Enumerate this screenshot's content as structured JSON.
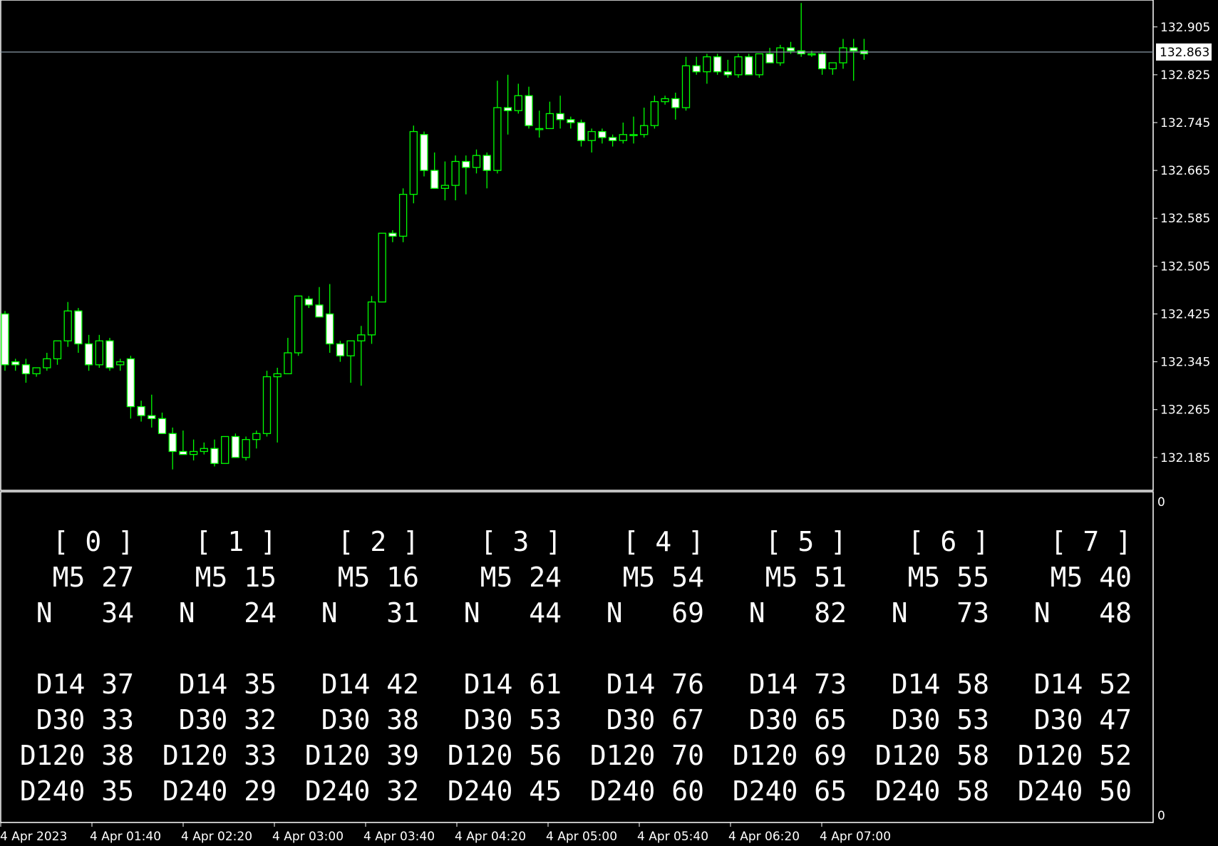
{
  "symbol_colors": {
    "background": "#000000",
    "bull_candle": "#00ff00",
    "bear_candle_fill": "#ffffff",
    "grid_line": "#ffffff",
    "bid_line": "#8a9aa6"
  },
  "price_axis": {
    "ticks": [
      "132.905",
      "132.825",
      "132.745",
      "132.665",
      "132.585",
      "132.505",
      "132.425",
      "132.345",
      "132.265",
      "132.185"
    ],
    "current_price": "132.863",
    "range": [
      132.13,
      132.95
    ]
  },
  "indicator_axis": {
    "top_label": "0",
    "bottom_label": "0"
  },
  "time_axis": {
    "labels": [
      "4 Apr 2023",
      "4 Apr 01:40",
      "4 Apr 02:20",
      "4 Apr 03:00",
      "4 Apr 03:40",
      "4 Apr 04:20",
      "4 Apr 05:00",
      "4 Apr 05:40",
      "4 Apr 06:20",
      "4 Apr 07:00"
    ]
  },
  "chart_data": {
    "type": "candlestick",
    "timeframe_minutes": 5,
    "start_time": "4 Apr 2023 00:00",
    "ohlc": [
      [
        132.425,
        132.43,
        132.33,
        132.34
      ],
      [
        132.345,
        132.35,
        132.33,
        132.34
      ],
      [
        132.34,
        132.35,
        132.31,
        132.325
      ],
      [
        132.325,
        132.335,
        132.32,
        132.335
      ],
      [
        132.335,
        132.36,
        132.33,
        132.35
      ],
      [
        132.35,
        132.38,
        132.34,
        132.38
      ],
      [
        132.38,
        132.445,
        132.37,
        132.43
      ],
      [
        132.43,
        132.435,
        132.36,
        132.375
      ],
      [
        132.375,
        132.39,
        132.33,
        132.34
      ],
      [
        132.34,
        132.39,
        132.335,
        132.38
      ],
      [
        132.38,
        132.385,
        132.33,
        132.335
      ],
      [
        132.34,
        132.35,
        132.33,
        132.345
      ],
      [
        132.35,
        132.355,
        132.25,
        132.27
      ],
      [
        132.27,
        132.28,
        132.245,
        132.255
      ],
      [
        132.255,
        132.29,
        132.235,
        132.25
      ],
      [
        132.25,
        132.26,
        132.23,
        132.225
      ],
      [
        132.225,
        132.235,
        132.165,
        132.195
      ],
      [
        132.195,
        132.23,
        132.19,
        132.19
      ],
      [
        132.19,
        132.215,
        132.18,
        132.195
      ],
      [
        132.195,
        132.21,
        132.19,
        132.2
      ],
      [
        132.2,
        132.215,
        132.17,
        132.175
      ],
      [
        132.175,
        132.22,
        132.175,
        132.22
      ],
      [
        132.22,
        132.225,
        132.185,
        132.185
      ],
      [
        132.185,
        132.22,
        132.18,
        132.215
      ],
      [
        132.215,
        132.23,
        132.2,
        132.225
      ],
      [
        132.225,
        132.33,
        132.22,
        132.32
      ],
      [
        132.32,
        132.335,
        132.21,
        132.325
      ],
      [
        132.325,
        132.385,
        132.325,
        132.36
      ],
      [
        132.36,
        132.455,
        132.355,
        132.455
      ],
      [
        132.45,
        132.455,
        132.435,
        132.44
      ],
      [
        132.44,
        132.47,
        132.42,
        132.42
      ],
      [
        132.425,
        132.475,
        132.36,
        132.375
      ],
      [
        132.375,
        132.38,
        132.345,
        132.355
      ],
      [
        132.355,
        132.375,
        132.31,
        132.38
      ],
      [
        132.38,
        132.405,
        132.305,
        132.39
      ],
      [
        132.39,
        132.455,
        132.375,
        132.445
      ],
      [
        132.445,
        132.56,
        132.445,
        132.56
      ],
      [
        132.56,
        132.565,
        132.545,
        132.555
      ],
      [
        132.555,
        132.635,
        132.545,
        132.625
      ],
      [
        132.625,
        132.74,
        132.61,
        132.73
      ],
      [
        132.725,
        132.73,
        132.655,
        132.665
      ],
      [
        132.665,
        132.695,
        132.635,
        132.635
      ],
      [
        132.635,
        132.68,
        132.615,
        132.64
      ],
      [
        132.64,
        132.69,
        132.615,
        132.68
      ],
      [
        132.68,
        132.69,
        132.625,
        132.67
      ],
      [
        132.67,
        132.7,
        132.66,
        132.69
      ],
      [
        132.69,
        132.695,
        132.635,
        132.665
      ],
      [
        132.665,
        132.815,
        132.66,
        132.77
      ],
      [
        132.77,
        132.825,
        132.725,
        132.765
      ],
      [
        132.765,
        132.81,
        132.76,
        132.79
      ],
      [
        132.79,
        132.805,
        132.735,
        132.74
      ],
      [
        132.735,
        132.765,
        132.72,
        132.735
      ],
      [
        132.735,
        132.78,
        132.735,
        132.76
      ],
      [
        132.76,
        132.79,
        132.735,
        132.75
      ],
      [
        132.75,
        132.755,
        132.735,
        132.745
      ],
      [
        132.745,
        132.75,
        132.705,
        132.715
      ],
      [
        132.715,
        132.735,
        132.695,
        132.73
      ],
      [
        132.73,
        132.735,
        132.71,
        132.72
      ],
      [
        132.72,
        132.725,
        132.705,
        132.715
      ],
      [
        132.715,
        132.745,
        132.71,
        132.725
      ],
      [
        132.725,
        132.755,
        132.71,
        132.725
      ],
      [
        132.725,
        132.77,
        132.72,
        132.74
      ],
      [
        132.74,
        132.79,
        132.735,
        132.78
      ],
      [
        132.78,
        132.79,
        132.775,
        132.785
      ],
      [
        132.785,
        132.795,
        132.75,
        132.77
      ],
      [
        132.77,
        132.855,
        132.765,
        132.84
      ],
      [
        132.84,
        132.855,
        132.825,
        132.83
      ],
      [
        132.83,
        132.86,
        132.81,
        132.855
      ],
      [
        132.855,
        132.86,
        132.825,
        132.83
      ],
      [
        132.83,
        132.85,
        132.82,
        132.825
      ],
      [
        132.825,
        132.86,
        132.82,
        132.855
      ],
      [
        132.855,
        132.86,
        132.825,
        132.825
      ],
      [
        132.825,
        132.86,
        132.82,
        132.86
      ],
      [
        132.86,
        132.87,
        132.845,
        132.845
      ],
      [
        132.845,
        132.875,
        132.84,
        132.87
      ],
      [
        132.87,
        132.88,
        132.86,
        132.865
      ],
      [
        132.865,
        132.945,
        132.855,
        132.86
      ],
      [
        132.86,
        132.865,
        132.855,
        132.86
      ],
      [
        132.86,
        132.865,
        132.825,
        132.835
      ],
      [
        132.835,
        132.845,
        132.825,
        132.845
      ],
      [
        132.845,
        132.885,
        132.835,
        132.87
      ],
      [
        132.87,
        132.885,
        132.815,
        132.865
      ],
      [
        132.865,
        132.885,
        132.85,
        132.86
      ]
    ],
    "bid_line": 132.863
  },
  "stats": {
    "columns": [
      {
        "header": "[ 0 ]",
        "lines": [
          "M5 27",
          "N   34",
          "",
          "D14 37",
          "D30 33",
          "D120 38",
          "D240 35"
        ]
      },
      {
        "header": "[ 1 ]",
        "lines": [
          "M5 15",
          "N   24",
          "",
          "D14 35",
          "D30 32",
          "D120 33",
          "D240 29"
        ]
      },
      {
        "header": "[ 2 ]",
        "lines": [
          "M5 16",
          "N   31",
          "",
          "D14 42",
          "D30 38",
          "D120 39",
          "D240 32"
        ]
      },
      {
        "header": "[ 3 ]",
        "lines": [
          "M5 24",
          "N   44",
          "",
          "D14 61",
          "D30 53",
          "D120 56",
          "D240 45"
        ]
      },
      {
        "header": "[ 4 ]",
        "lines": [
          "M5 54",
          "N   69",
          "",
          "D14 76",
          "D30 67",
          "D120 70",
          "D240 60"
        ]
      },
      {
        "header": "[ 5 ]",
        "lines": [
          "M5 51",
          "N   82",
          "",
          "D14 73",
          "D30 65",
          "D120 69",
          "D240 65"
        ]
      },
      {
        "header": "[ 6 ]",
        "lines": [
          "M5 55",
          "N   73",
          "",
          "D14 58",
          "D30 53",
          "D120 58",
          "D240 58"
        ]
      },
      {
        "header": "[ 7 ]",
        "lines": [
          "M5 40",
          "N   48",
          "",
          "D14 52",
          "D30 47",
          "D120 52",
          "D240 50"
        ]
      }
    ]
  }
}
